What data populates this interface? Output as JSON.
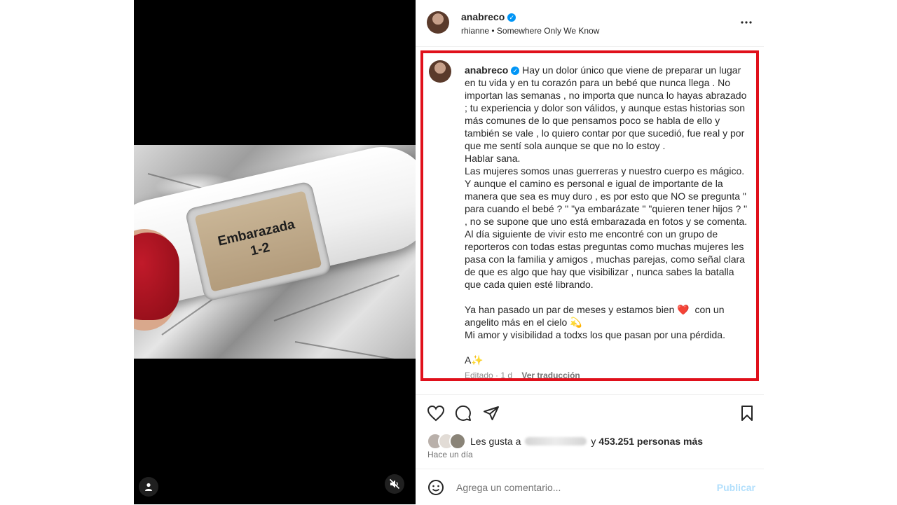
{
  "post": {
    "author": "anabreco",
    "music": "rhianne • Somewhere Only We Know",
    "test_display_line1": "Embarazada",
    "test_display_line2": "1-2"
  },
  "caption": {
    "author": "anabreco",
    "paragraphs": [
      "Hay un dolor único que viene de preparar un lugar en tu vida y en tu corazón para un bebé que nunca llega . No importan las semanas , no importa que nunca lo hayas abrazado ; tu experiencia y dolor son válidos, y aunque estas historias son más comunes de lo que pensamos poco se habla de ello y también se vale , lo quiero contar por que sucedió, fue real y por que me sentí sola aunque se que no lo estoy .\nHablar sana.\nLas mujeres somos unas guerreras y nuestro cuerpo es mágico.\nY aunque el camino es personal e igual de importante de la manera que sea es muy duro , es por esto que NO se pregunta \" para cuando el bebé ? \" \"ya embarázate \" \"quieren tener hijos ? \" , no se supone que uno está embarazada en fotos y se comenta.\nAl día siguiente de vivir esto me encontré con un grupo de reporteros con todas estas preguntas como muchas mujeres les pasa con la familia y amigos , muchas parejas, como señal clara de que es algo que hay que visibilizar , nunca sabes la batalla que cada quien esté librando.",
      "Ya han pasado un par de meses y estamos bien ❤️  con un angelito más en el cielo 💫\nMi amor y visibilidad a todxs los que pasan por una pérdida.",
      "A✨"
    ],
    "edited": "Editado · 1 d",
    "translate": "Ver traducción"
  },
  "likes": {
    "prefix": "Les gusta a",
    "joiner": "y",
    "count": "453.251 personas más"
  },
  "timestamp": "Hace un día",
  "comment": {
    "placeholder": "Agrega un comentario...",
    "publish": "Publicar"
  },
  "colors": {
    "highlight_border": "#e0101b",
    "verified": "#0095f6",
    "publish_disabled": "#b2dffc"
  }
}
